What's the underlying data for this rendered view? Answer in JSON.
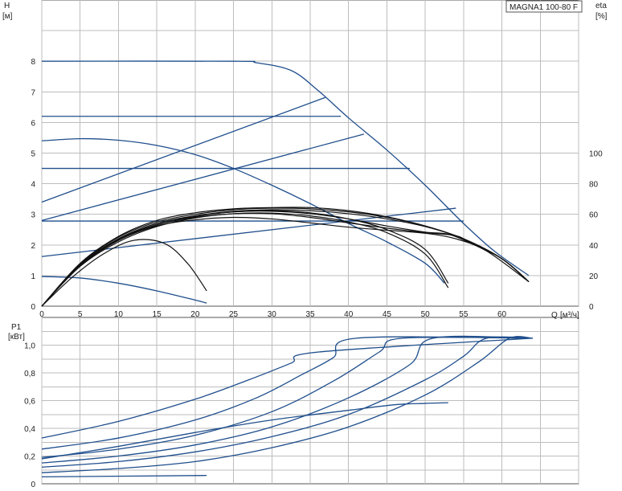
{
  "title": "MAGNA1 100-80 F",
  "colors": {
    "blue": "#1f4e8c",
    "black": "#111111",
    "grid": "#bdbdbd"
  },
  "chart_data": [
    {
      "type": "line",
      "name": "head",
      "ylabel": "H",
      "yunit": "[м]",
      "y2label": "eta",
      "y2unit": "[%]",
      "xlabel": "Q",
      "xunit": "[м³/ч]",
      "xlim": [
        0,
        70
      ],
      "ylim": [
        0,
        10
      ],
      "y2lim": [
        0,
        200
      ],
      "xticks": [
        0,
        5,
        10,
        15,
        20,
        25,
        30,
        35,
        40,
        45,
        50,
        55,
        60
      ],
      "yticks": [
        0,
        1,
        2,
        3,
        4,
        5,
        6,
        7,
        8
      ],
      "y2ticks": [
        0,
        20,
        40,
        60,
        80,
        100
      ],
      "grid": true,
      "series": [
        {
          "color": "blue",
          "values": [
            [
              0,
              8
            ],
            [
              25,
              8
            ],
            [
              28,
              7.95
            ],
            [
              32.5,
              7.7
            ],
            [
              36,
              7.05
            ],
            [
              40,
              6.15
            ],
            [
              45,
              5.1
            ],
            [
              50,
              3.95
            ],
            [
              55,
              2.7
            ],
            [
              59,
              1.8
            ],
            [
              63.5,
              1.0
            ]
          ]
        },
        {
          "color": "blue",
          "values": [
            [
              0,
              6.2
            ],
            [
              39,
              6.2
            ]
          ]
        },
        {
          "color": "blue",
          "values": [
            [
              0,
              4.5
            ],
            [
              48,
              4.5
            ]
          ]
        },
        {
          "color": "blue",
          "values": [
            [
              0,
              2.78
            ],
            [
              55,
              2.78
            ]
          ]
        },
        {
          "color": "blue",
          "values": [
            [
              0,
              1.62
            ],
            [
              54,
              3.2
            ]
          ]
        },
        {
          "color": "blue",
          "values": [
            [
              0,
              2.8
            ],
            [
              42,
              5.62
            ]
          ]
        },
        {
          "color": "blue",
          "values": [
            [
              0,
              3.4
            ],
            [
              37,
              6.82
            ]
          ]
        },
        {
          "color": "blue",
          "values": [
            [
              0,
              5.4
            ],
            [
              5,
              5.47
            ],
            [
              10,
              5.42
            ],
            [
              15,
              5.25
            ],
            [
              20,
              4.95
            ],
            [
              25,
              4.5
            ],
            [
              30,
              3.95
            ],
            [
              35,
              3.35
            ],
            [
              40,
              2.7
            ],
            [
              45,
              2.1
            ],
            [
              50,
              1.4
            ],
            [
              52.5,
              0.75
            ]
          ]
        },
        {
          "color": "blue",
          "values": [
            [
              0,
              0.97
            ],
            [
              5,
              0.92
            ],
            [
              10,
              0.75
            ],
            [
              15,
              0.5
            ],
            [
              20,
              0.2
            ],
            [
              21.5,
              0.1
            ]
          ]
        },
        {
          "color": "black",
          "values": [
            [
              0,
              0
            ],
            [
              4,
              0.95
            ],
            [
              8,
              1.7
            ],
            [
              12,
              2.15
            ],
            [
              16,
              2.05
            ],
            [
              19,
              1.4
            ],
            [
              21.5,
              0.5
            ]
          ]
        },
        {
          "color": "black",
          "values": [
            [
              0,
              0
            ],
            [
              5,
              1.3
            ],
            [
              10,
              2.1
            ],
            [
              15,
              2.6
            ],
            [
              20,
              2.88
            ],
            [
              25,
              3.02
            ],
            [
              30,
              3.04
            ],
            [
              35,
              2.95
            ],
            [
              40,
              2.75
            ],
            [
              45,
              2.4
            ],
            [
              50,
              1.7
            ],
            [
              53,
              0.6
            ]
          ]
        },
        {
          "color": "black",
          "values": [
            [
              0,
              0
            ],
            [
              5,
              1.32
            ],
            [
              10,
              2.15
            ],
            [
              15,
              2.65
            ],
            [
              20,
              2.93
            ],
            [
              25,
              3.08
            ],
            [
              30,
              3.12
            ],
            [
              35,
              3.05
            ],
            [
              40,
              2.85
            ],
            [
              45,
              2.5
            ],
            [
              50,
              1.85
            ],
            [
              53,
              0.75
            ]
          ]
        },
        {
          "color": "black",
          "values": [
            [
              0,
              0
            ],
            [
              5,
              1.35
            ],
            [
              10,
              2.2
            ],
            [
              15,
              2.7
            ],
            [
              20,
              2.95
            ],
            [
              25,
              3.1
            ],
            [
              30,
              3.15
            ],
            [
              35,
              3.12
            ],
            [
              40,
              3.02
            ],
            [
              45,
              2.85
            ],
            [
              50,
              2.6
            ],
            [
              55,
              2.2
            ],
            [
              60,
              1.55
            ],
            [
              63.5,
              0.8
            ]
          ]
        },
        {
          "color": "black",
          "values": [
            [
              0,
              0
            ],
            [
              5,
              1.38
            ],
            [
              10,
              2.25
            ],
            [
              15,
              2.75
            ],
            [
              20,
              3.0
            ],
            [
              25,
              3.15
            ],
            [
              30,
              3.2
            ],
            [
              35,
              3.18
            ],
            [
              40,
              3.08
            ],
            [
              45,
              2.9
            ],
            [
              50,
              2.62
            ],
            [
              55,
              2.2
            ],
            [
              60,
              1.55
            ],
            [
              63.5,
              0.8
            ]
          ]
        },
        {
          "color": "black",
          "values": [
            [
              0,
              0
            ],
            [
              5,
              1.4
            ],
            [
              10,
              2.28
            ],
            [
              15,
              2.8
            ],
            [
              20,
              3.05
            ],
            [
              25,
              3.18
            ],
            [
              30,
              3.22
            ],
            [
              35,
              3.22
            ],
            [
              40,
              3.12
            ],
            [
              45,
              2.92
            ],
            [
              50,
              2.62
            ],
            [
              55,
              2.2
            ],
            [
              60,
              1.55
            ],
            [
              63.5,
              0.8
            ]
          ]
        },
        {
          "color": "black",
          "values": [
            [
              0,
              0
            ],
            [
              5,
              1.36
            ],
            [
              10,
              2.2
            ],
            [
              15,
              2.7
            ],
            [
              20,
              2.95
            ],
            [
              25,
              3.08
            ],
            [
              30,
              3.1
            ],
            [
              35,
              3.02
            ],
            [
              40,
              2.85
            ],
            [
              45,
              2.62
            ],
            [
              50,
              2.42
            ],
            [
              53,
              2.35
            ],
            [
              56,
              2.05
            ],
            [
              60,
              1.55
            ],
            [
              63.5,
              0.8
            ]
          ]
        },
        {
          "color": "black",
          "values": [
            [
              0,
              0
            ],
            [
              5,
              1.34
            ],
            [
              10,
              2.18
            ],
            [
              15,
              2.66
            ],
            [
              20,
              2.9
            ],
            [
              25,
              3.02
            ],
            [
              30,
              3.02
            ],
            [
              35,
              2.9
            ],
            [
              40,
              2.72
            ],
            [
              45,
              2.55
            ],
            [
              50,
              2.4
            ],
            [
              54,
              2.3
            ],
            [
              56,
              2.05
            ],
            [
              60,
              1.55
            ],
            [
              63.5,
              0.8
            ]
          ]
        },
        {
          "color": "black",
          "values": [
            [
              0,
              0
            ],
            [
              5,
              1.33
            ],
            [
              10,
              2.15
            ],
            [
              15,
              2.62
            ],
            [
              20,
              2.82
            ],
            [
              25,
              2.9
            ],
            [
              30,
              2.85
            ],
            [
              35,
              2.72
            ],
            [
              40,
              2.58
            ],
            [
              45,
              2.48
            ],
            [
              50,
              2.38
            ],
            [
              54,
              2.2
            ],
            [
              58,
              1.8
            ],
            [
              63.5,
              0.8
            ]
          ]
        }
      ]
    },
    {
      "type": "line",
      "name": "power",
      "ylabel": "P1",
      "yunit": "[кВт]",
      "xlim": [
        0,
        70
      ],
      "ylim": [
        0,
        1.2
      ],
      "yticks": [
        "0",
        "0,2",
        "0,4",
        "0,6",
        "0,8",
        "1,0"
      ],
      "ytick_values": [
        0,
        0.2,
        0.4,
        0.6,
        0.8,
        1.0
      ],
      "grid": true,
      "series": [
        {
          "color": "blue",
          "values": [
            [
              0,
              0.33
            ],
            [
              10,
              0.45
            ],
            [
              20,
              0.61
            ],
            [
              27,
              0.75
            ],
            [
              32.5,
              0.87
            ],
            [
              36,
              0.95
            ],
            [
              64,
              1.05
            ]
          ]
        },
        {
          "color": "blue",
          "values": [
            [
              0,
              0.25
            ],
            [
              10,
              0.33
            ],
            [
              20,
              0.46
            ],
            [
              28,
              0.62
            ],
            [
              34,
              0.79
            ],
            [
              38,
              0.91
            ],
            [
              41,
              1.05
            ],
            [
              64,
              1.05
            ]
          ]
        },
        {
          "color": "blue",
          "values": [
            [
              0,
              0.19
            ],
            [
              10,
              0.25
            ],
            [
              20,
              0.35
            ],
            [
              30,
              0.52
            ],
            [
              38,
              0.74
            ],
            [
              44,
              0.95
            ],
            [
              47,
              1.05
            ],
            [
              64,
              1.05
            ]
          ]
        },
        {
          "color": "blue",
          "values": [
            [
              0,
              0.15
            ],
            [
              10,
              0.2
            ],
            [
              20,
              0.28
            ],
            [
              30,
              0.41
            ],
            [
              40,
              0.62
            ],
            [
              48,
              0.86
            ],
            [
              51,
              1.05
            ],
            [
              64,
              1.05
            ]
          ]
        },
        {
          "color": "blue",
          "values": [
            [
              0,
              0.12
            ],
            [
              10,
              0.16
            ],
            [
              20,
              0.23
            ],
            [
              30,
              0.34
            ],
            [
              40,
              0.5
            ],
            [
              50,
              0.75
            ],
            [
              55,
              0.92
            ],
            [
              58,
              1.05
            ],
            [
              64,
              1.05
            ]
          ]
        },
        {
          "color": "blue",
          "values": [
            [
              0,
              0.08
            ],
            [
              10,
              0.11
            ],
            [
              20,
              0.16
            ],
            [
              30,
              0.26
            ],
            [
              40,
              0.41
            ],
            [
              50,
              0.64
            ],
            [
              57,
              0.88
            ],
            [
              61,
              1.05
            ],
            [
              64,
              1.05
            ]
          ]
        },
        {
          "color": "blue",
          "values": [
            [
              0,
              0.18
            ],
            [
              10,
              0.27
            ],
            [
              20,
              0.37
            ],
            [
              30,
              0.46
            ],
            [
              40,
              0.53
            ],
            [
              46,
              0.57
            ],
            [
              50,
              0.58
            ],
            [
              53,
              0.585
            ]
          ]
        },
        {
          "color": "blue",
          "values": [
            [
              0,
              0.05
            ],
            [
              21.5,
              0.06
            ]
          ]
        }
      ]
    }
  ]
}
